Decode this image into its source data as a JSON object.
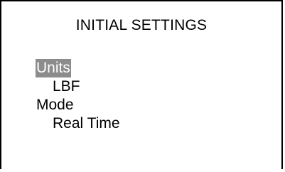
{
  "screen": {
    "title": "INITIAL SETTINGS",
    "selected_index": 0,
    "items": [
      {
        "label": "Units",
        "level": "setting",
        "selected": true
      },
      {
        "label": "LBF",
        "level": "value",
        "selected": false
      },
      {
        "label": "Mode",
        "level": "setting",
        "selected": false
      },
      {
        "label": "Real Time",
        "level": "value",
        "selected": false
      }
    ]
  },
  "colors": {
    "background": "#ffffff",
    "text": "#000000",
    "highlight": "#8c8c8c",
    "highlight_text": "#ffffff",
    "border": "#000000"
  }
}
